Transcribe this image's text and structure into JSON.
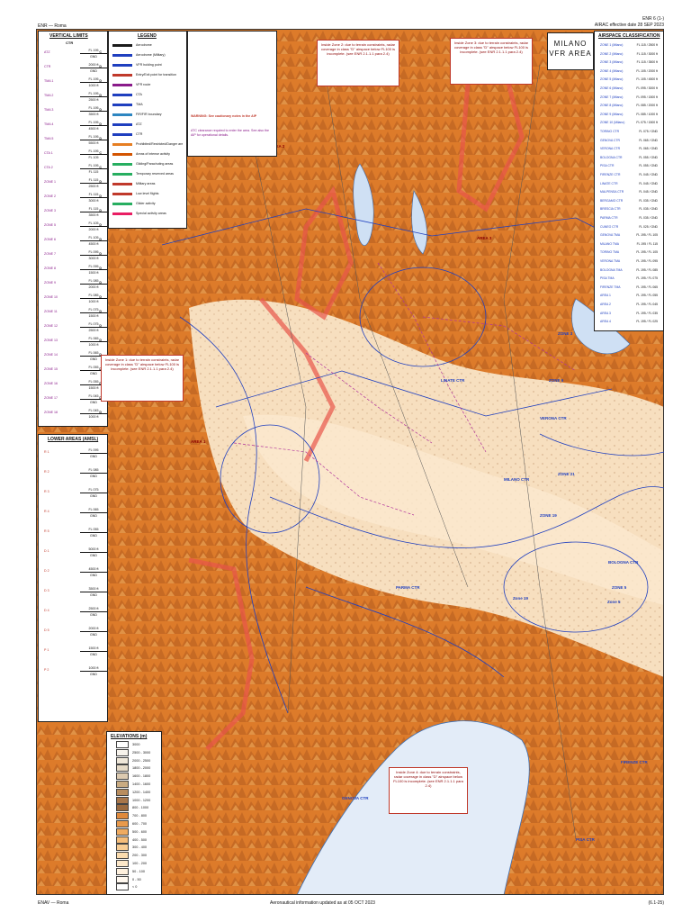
{
  "header": {
    "top_right_1": "ENR 6 (1-)",
    "top_right_2": "AIRAC effective date 28 SEP 2023",
    "top_left": "ENR — Roma"
  },
  "footer": {
    "left": "ENAV — Roma",
    "center": "Aeronautical information updated as at 05 OCT 2023",
    "right": "(6.1-25)"
  },
  "panels": {
    "vertical_limits_title": "VERTICAL LIMITS",
    "legend_title": "LEGEND",
    "airspace_classification_title": "AIRSPACE CLASSIFICATION",
    "elevations_title": "ELEVATIONS (m)",
    "lower_areas_title": "LOWER AREAS (AMSL)",
    "map_title_line1": "MILANO",
    "map_title_line2": "VFR AREA",
    "ctr_label": "CTR"
  },
  "legend_items": [
    {
      "label": "Aerodrome",
      "color": "#1a1a1a"
    },
    {
      "label": "Aerodrome (Military)",
      "color": "#1f3fbf"
    },
    {
      "label": "VFR holding point",
      "color": "#1f3fbf"
    },
    {
      "label": "Entry/Exit point for transition",
      "color": "#c0392b"
    },
    {
      "label": "VFR route",
      "color": "#8a1b8a"
    },
    {
      "label": "CTA",
      "color": "#1f3fbf"
    },
    {
      "label": "TMA",
      "color": "#1f3fbf"
    },
    {
      "label": "FIR/FIR boundary",
      "color": "#2e86c1"
    },
    {
      "label": "ATZ",
      "color": "#1f3fbf"
    },
    {
      "label": "CTR",
      "color": "#1f3fbf"
    },
    {
      "label": "Prohibited/Restricted/Danger areas",
      "color": "#e67e22"
    },
    {
      "label": "Areas of intense activity",
      "color": "#d35400"
    },
    {
      "label": "Gliding/Parachuting areas",
      "color": "#27ae60"
    },
    {
      "label": "Temporary reserved areas",
      "color": "#27ae60"
    },
    {
      "label": "Military areas",
      "color": "#c0392b"
    },
    {
      "label": "Low level flights",
      "color": "#c0392b"
    },
    {
      "label": "Glider activity",
      "color": "#27ae60"
    },
    {
      "label": "Special activity areas",
      "color": "#e91e63"
    }
  ],
  "legend_warning": "WARNING: See cautionary notes in the AIP",
  "vertical_limits": [
    {
      "label": "ATZ",
      "top": "FL 195",
      "bottom": "GND",
      "cls": "C"
    },
    {
      "label": "CTR",
      "top": "2000 ft",
      "bottom": "GND",
      "cls": "D"
    },
    {
      "label": "TMA 1",
      "top": "FL 195",
      "bottom": "1000 ft",
      "cls": "D"
    },
    {
      "label": "TMA 2",
      "top": "FL 195",
      "bottom": "2500 ft",
      "cls": "D"
    },
    {
      "label": "TMA 3",
      "top": "FL 195",
      "bottom": "3500 ft",
      "cls": "D"
    },
    {
      "label": "TMA 4",
      "top": "FL 195",
      "bottom": "4500 ft",
      "cls": "D"
    },
    {
      "label": "TMA 5",
      "top": "FL 195",
      "bottom": "5500 ft",
      "cls": "D"
    },
    {
      "label": "CTA 1",
      "top": "FL 195",
      "bottom": "FL 105",
      "cls": "C"
    },
    {
      "label": "CTA 2",
      "top": "FL 195",
      "bottom": "FL 115",
      "cls": "C"
    },
    {
      "label": "ZONE 1",
      "top": "FL 115",
      "bottom": "2500 ft",
      "cls": "D"
    },
    {
      "label": "ZONE 2",
      "top": "FL 115",
      "bottom": "3000 ft",
      "cls": "D"
    },
    {
      "label": "ZONE 3",
      "top": "FL 115",
      "bottom": "3500 ft",
      "cls": "D"
    },
    {
      "label": "ZONE 5",
      "top": "FL 105",
      "bottom": "2000 ft",
      "cls": "D"
    },
    {
      "label": "ZONE 6",
      "top": "FL 105",
      "bottom": "4500 ft",
      "cls": "D"
    },
    {
      "label": "ZONE 7",
      "top": "FL 095",
      "bottom": "3000 ft",
      "cls": "D"
    },
    {
      "label": "ZONE 8",
      "top": "FL 095",
      "bottom": "1500 ft",
      "cls": "D"
    },
    {
      "label": "ZONE 9",
      "top": "FL 085",
      "bottom": "2000 ft",
      "cls": "D"
    },
    {
      "label": "ZONE 10",
      "top": "FL 085",
      "bottom": "1000 ft",
      "cls": "D"
    },
    {
      "label": "ZONE 11",
      "top": "FL 075",
      "bottom": "1500 ft",
      "cls": "D"
    },
    {
      "label": "ZONE 12",
      "top": "FL 075",
      "bottom": "2500 ft",
      "cls": "D"
    },
    {
      "label": "ZONE 13",
      "top": "FL 065",
      "bottom": "1000 ft",
      "cls": "D"
    },
    {
      "label": "ZONE 14",
      "top": "FL 065",
      "bottom": "GND",
      "cls": "D"
    },
    {
      "label": "ZONE 15",
      "top": "FL 055",
      "bottom": "GND",
      "cls": "D"
    },
    {
      "label": "ZONE 16",
      "top": "FL 055",
      "bottom": "1500 ft",
      "cls": "D"
    },
    {
      "label": "ZONE 17",
      "top": "FL 045",
      "bottom": "GND",
      "cls": "D"
    },
    {
      "label": "ZONE 18",
      "top": "FL 045",
      "bottom": "1000 ft",
      "cls": "D"
    }
  ],
  "lower_areas": [
    {
      "label": "R 1",
      "top": "FL 095",
      "bottom": "GND"
    },
    {
      "label": "R 2",
      "top": "FL 085",
      "bottom": "GND"
    },
    {
      "label": "R 3",
      "top": "FL 075",
      "bottom": "GND"
    },
    {
      "label": "R 4",
      "top": "FL 065",
      "bottom": "GND"
    },
    {
      "label": "R 5",
      "top": "FL 055",
      "bottom": "GND"
    },
    {
      "label": "D 1",
      "top": "5000 ft",
      "bottom": "GND"
    },
    {
      "label": "D 2",
      "top": "4500 ft",
      "bottom": "GND"
    },
    {
      "label": "D 3",
      "top": "3500 ft",
      "bottom": "GND"
    },
    {
      "label": "D 4",
      "top": "2500 ft",
      "bottom": "GND"
    },
    {
      "label": "D 5",
      "top": "2000 ft",
      "bottom": "GND"
    },
    {
      "label": "P 1",
      "top": "1500 ft",
      "bottom": "GND"
    },
    {
      "label": "P 2",
      "top": "1000 ft",
      "bottom": "GND"
    }
  ],
  "airspace_classes": [
    {
      "label": "ZONE 1 (Milano)",
      "top": "FL 115",
      "bottom": "2500 ft"
    },
    {
      "label": "ZONE 2 (Milano)",
      "top": "FL 115",
      "bottom": "3000 ft"
    },
    {
      "label": "ZONE 3 (Milano)",
      "top": "FL 115",
      "bottom": "3500 ft"
    },
    {
      "label": "ZONE 4 (Milano)",
      "top": "FL 105",
      "bottom": "2000 ft"
    },
    {
      "label": "ZONE 5 (Milano)",
      "top": "FL 105",
      "bottom": "4500 ft"
    },
    {
      "label": "ZONE 6 (Milano)",
      "top": "FL 095",
      "bottom": "3000 ft"
    },
    {
      "label": "ZONE 7 (Milano)",
      "top": "FL 095",
      "bottom": "1500 ft"
    },
    {
      "label": "ZONE 8 (Milano)",
      "top": "FL 085",
      "bottom": "2000 ft"
    },
    {
      "label": "ZONE 9 (Milano)",
      "top": "FL 085",
      "bottom": "1000 ft"
    },
    {
      "label": "ZONE 10 (Milano)",
      "top": "FL 075",
      "bottom": "1500 ft"
    },
    {
      "label": "TORINO CTR",
      "top": "FL 075",
      "bottom": "GND"
    },
    {
      "label": "GENOVA CTR",
      "top": "FL 065",
      "bottom": "GND"
    },
    {
      "label": "VERONA CTR",
      "top": "FL 065",
      "bottom": "GND"
    },
    {
      "label": "BOLOGNA CTR",
      "top": "FL 055",
      "bottom": "GND"
    },
    {
      "label": "PISA CTR",
      "top": "FL 055",
      "bottom": "GND"
    },
    {
      "label": "FIRENZE CTR",
      "top": "FL 045",
      "bottom": "GND"
    },
    {
      "label": "LINATE CTR",
      "top": "FL 045",
      "bottom": "GND"
    },
    {
      "label": "MALPENSA CTR",
      "top": "FL 045",
      "bottom": "GND"
    },
    {
      "label": "BERGAMO CTR",
      "top": "FL 035",
      "bottom": "GND"
    },
    {
      "label": "BRESCIA CTR",
      "top": "FL 035",
      "bottom": "GND"
    },
    {
      "label": "PARMA CTR",
      "top": "FL 035",
      "bottom": "GND"
    },
    {
      "label": "CUNEO CTR",
      "top": "FL 025",
      "bottom": "GND"
    },
    {
      "label": "GENOVA TMA",
      "top": "FL 195",
      "bottom": "FL 105"
    },
    {
      "label": "MILANO TMA",
      "top": "FL 195",
      "bottom": "FL 115"
    },
    {
      "label": "TORINO TMA",
      "top": "FL 195",
      "bottom": "FL 105"
    },
    {
      "label": "VERONA TMA",
      "top": "FL 195",
      "bottom": "FL 095"
    },
    {
      "label": "BOLOGNA TMA",
      "top": "FL 195",
      "bottom": "FL 085"
    },
    {
      "label": "PISA TMA",
      "top": "FL 195",
      "bottom": "FL 075"
    },
    {
      "label": "FIRENZE TMA",
      "top": "FL 195",
      "bottom": "FL 065"
    },
    {
      "label": "AREA 1",
      "top": "FL 195",
      "bottom": "FL 055"
    },
    {
      "label": "AREA 2",
      "top": "FL 195",
      "bottom": "FL 045"
    },
    {
      "label": "AREA 3",
      "top": "FL 195",
      "bottom": "FL 035"
    },
    {
      "label": "AREA 4",
      "top": "FL 195",
      "bottom": "FL 025"
    }
  ],
  "elevations": [
    {
      "label": "3000",
      "color": "#ffffff"
    },
    {
      "label": "2500 - 3000",
      "color": "#f7f3ec"
    },
    {
      "label": "2000 - 2500",
      "color": "#efe7d9"
    },
    {
      "label": "1800 - 2000",
      "color": "#e6dac6"
    },
    {
      "label": "1600 - 1800",
      "color": "#dccab0"
    },
    {
      "label": "1400 - 1600",
      "color": "#c9ab82"
    },
    {
      "label": "1200 - 1400",
      "color": "#b98d5e"
    },
    {
      "label": "1000 - 1200",
      "color": "#a8764a"
    },
    {
      "label": "800 - 1000",
      "color": "#9b6a3f"
    },
    {
      "label": "700 - 800",
      "color": "#e08a3c"
    },
    {
      "label": "600 - 700",
      "color": "#e99a4c"
    },
    {
      "label": "500 - 600",
      "color": "#f0ab60"
    },
    {
      "label": "400 - 500",
      "color": "#f5bd7a"
    },
    {
      "label": "300 - 400",
      "color": "#f8cd94"
    },
    {
      "label": "200 - 300",
      "color": "#fbdcaf"
    },
    {
      "label": "100 - 200",
      "color": "#fde8c9"
    },
    {
      "label": "50 - 100",
      "color": "#fff1de"
    },
    {
      "label": "0 - 50",
      "color": "#fff8ef"
    },
    {
      "label": "< 0",
      "color": "#ffffff"
    }
  ],
  "notes": {
    "n1": "Inside Zone 1: due to terrain constraints, radar coverage in class \"D\" airspace below FL100 is incomplete. (see ENR 2.1.1.1 para 2.4)",
    "n2": "Inside Zone 2: due to terrain constraints, radar coverage in class \"D\" airspace below FL100 is incomplete. (see ENR 2.1.1.1 para 2.4)",
    "n3": "Inside Zone 3: due to terrain constraints, radar coverage in class \"D\" airspace below FL100 is incomplete. (see ENR 2.1.1.1 para 2.4)",
    "n4": "Inside Zone 4: due to terrain constraints, radar coverage in class \"D\" airspace below FL100 is incomplete. (see ENR 2.1.1.1 para 2.4)",
    "n5": "ATC clearance required to enter the area. See also the AIP for operational details."
  },
  "map_labels": [
    {
      "text": "AREA 2",
      "color": "#8b0000"
    },
    {
      "text": "AREA 3",
      "color": "#8b0000"
    },
    {
      "text": "AREA 1",
      "color": "#8b0000"
    },
    {
      "text": "ZONE 3",
      "color": "#1f3fbf"
    },
    {
      "text": "ZONE 5",
      "color": "#1f3fbf"
    },
    {
      "text": "ZONE 6",
      "color": "#1f3fbf"
    },
    {
      "text": "ZONE 19",
      "color": "#1f3fbf"
    },
    {
      "text": "ZONE 21",
      "color": "#1f3fbf"
    },
    {
      "text": "MILANO CTR",
      "color": "#1f3fbf"
    },
    {
      "text": "LINATE CTR",
      "color": "#1f3fbf"
    },
    {
      "text": "VERONA CTR",
      "color": "#1f3fbf"
    },
    {
      "text": "BOLOGNA CTR",
      "color": "#1f3fbf"
    },
    {
      "text": "GENOVA CTR",
      "color": "#1f3fbf"
    },
    {
      "text": "FIRENZE CTR",
      "color": "#1f3fbf"
    },
    {
      "text": "PISA CTR",
      "color": "#1f3fbf"
    },
    {
      "text": "Zone 5",
      "color": "#1f3fbf"
    },
    {
      "text": "Zone 19",
      "color": "#1f3fbf"
    },
    {
      "text": "PARMA CTR",
      "color": "#1f3fbf"
    }
  ],
  "colors": {
    "terrain_high": "#d97a2b",
    "terrain_low": "#f6d9b4",
    "sea": "#dfe9f7",
    "lake": "#c9dcf2",
    "airspace_blue": "#1f3fbf",
    "restricted_red": "#e8564a",
    "vfr_magenta": "#b0339b"
  }
}
